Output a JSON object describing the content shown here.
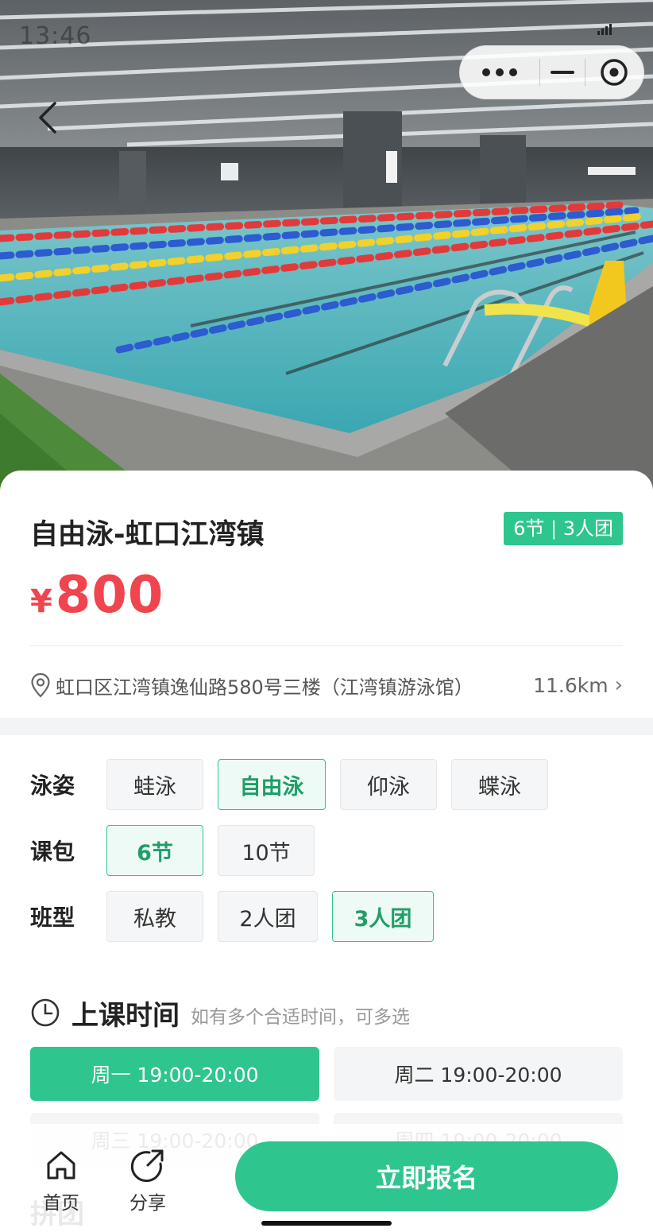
{
  "status_bar": {
    "time": "13:46"
  },
  "course": {
    "title": "自由泳-虹口江湾镇",
    "badge": "6节 | 3人团",
    "price_currency": "¥",
    "price_value": "800"
  },
  "location": {
    "address": "虹口区江湾镇逸仙路580号三楼（江湾镇游泳馆）",
    "distance": "11.6km",
    "chevron": "›"
  },
  "options": {
    "stroke": {
      "label": "泳姿",
      "choices": [
        {
          "label": "蛙泳",
          "selected": false
        },
        {
          "label": "自由泳",
          "selected": true
        },
        {
          "label": "仰泳",
          "selected": false
        },
        {
          "label": "蝶泳",
          "selected": false
        }
      ]
    },
    "package": {
      "label": "课包",
      "choices": [
        {
          "label": "6节",
          "selected": true
        },
        {
          "label": "10节",
          "selected": false
        }
      ]
    },
    "class_type": {
      "label": "班型",
      "choices": [
        {
          "label": "私教",
          "selected": false
        },
        {
          "label": "2人团",
          "selected": false
        },
        {
          "label": "3人团",
          "selected": true
        }
      ]
    }
  },
  "schedule": {
    "title": "上课时间",
    "hint": "如有多个合适时间，可多选",
    "slots": [
      {
        "label": "周一 19:00-20:00",
        "selected": true
      },
      {
        "label": "周二 19:00-20:00",
        "selected": false
      },
      {
        "label": "周三 19:00-20:00",
        "selected": false
      },
      {
        "label": "周四 19:00-20:00",
        "selected": false
      }
    ]
  },
  "next_section": {
    "title": "拼团"
  },
  "bottom_bar": {
    "home_label": "首页",
    "share_label": "分享",
    "cta_label": "立即报名"
  },
  "colors": {
    "accent": "#2fc58e",
    "price": "#f0444e",
    "pool_water": "#4fb8bf"
  },
  "icons": {
    "back": "chevron-left-icon",
    "more": "more-dots-icon",
    "minimize": "minimize-icon",
    "close": "target-close-icon",
    "location": "location-pin-icon",
    "clock": "clock-icon",
    "home": "home-icon",
    "share": "share-icon"
  }
}
